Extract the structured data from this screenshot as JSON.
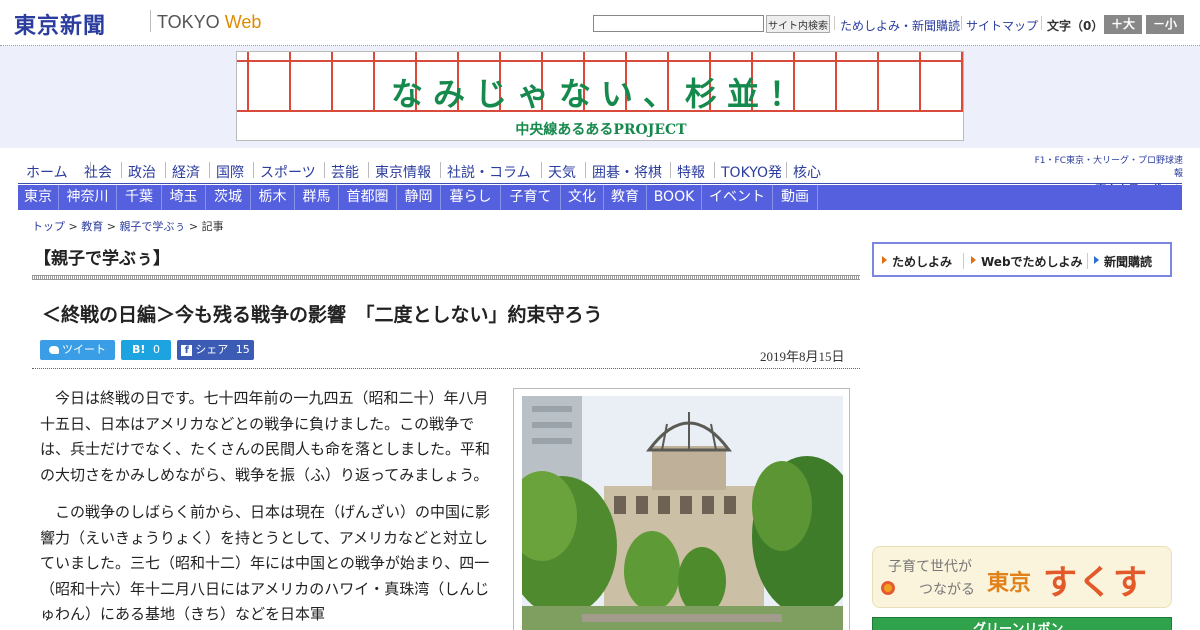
{
  "header": {
    "logo_jp": "東京新聞",
    "logo_en_tokyo": "TOKYO",
    "logo_en_web": "Web",
    "search_placeholder": "",
    "search_button": "サイト内検索",
    "links": [
      "ためしよみ・新聞購読",
      "サイトマップ"
    ],
    "font_size_label": "文字（0）",
    "font_bigger": "＋大",
    "font_smaller": "－小"
  },
  "banner": {
    "title": "なみじゃない、杉並！",
    "subtitle": "中央線あるあるPROJECT"
  },
  "nav_primary": [
    "ホーム",
    "社会",
    "政治",
    "経済",
    "国際",
    "スポーツ",
    "芸能",
    "東京情報",
    "社説・コラム",
    "天気",
    "囲碁・将棋",
    "特報",
    "TOKYO発",
    "核心"
  ],
  "sports_promo": {
    "line1": "F1・FC東京・大リーグ・プロ野球速報",
    "line2": "東京中日スポーツ"
  },
  "nav_regional": [
    "東京",
    "神奈川",
    "千葉",
    "埼玉",
    "茨城",
    "栃木",
    "群馬",
    "首都圏",
    "静岡",
    "暮らし",
    "子育て",
    "文化",
    "教育",
    "BOOK",
    "イベント",
    "動画"
  ],
  "breadcrumb": {
    "items": [
      "トップ",
      "教育",
      "親子で学ぶぅ"
    ],
    "current": "記事",
    "sep": " > "
  },
  "section_title": "【親子で学ぶぅ】",
  "article": {
    "title": "＜終戦の日編＞今も残る戦争の影響　「二度としない」約束守ろう",
    "date": "2019年8月15日",
    "share": {
      "tweet": "ツイート",
      "hatena": "B!",
      "hatena_count": "0",
      "fb_label": "シェア",
      "fb_count": "15"
    },
    "paragraphs": [
      "今日は終戦の日です。七十四年前の一九四五（昭和二十）年八月十五日、日本はアメリカなどとの戦争に負けました。この戦争では、兵士だけでなく、たくさんの民間人も命を落としました。平和の大切さをかみしめながら、戦争を振（ふ）り返ってみましょう。",
      "この戦争のしばらく前から、日本は現在（げんざい）の中国に影響力（えいきょうりょく）を持とうとして、アメリカなどと対立していました。三七（昭和十二）年には中国との戦争が始まり、四一（昭和十六）年十二月八日にはアメリカのハワイ・真珠湾（しんじゅわん）にある基地（きち）などを日本軍"
    ]
  },
  "sidebar": {
    "subscribe_links": [
      "ためしよみ",
      "Webでためしよみ",
      "新聞購読"
    ],
    "sukusuku": {
      "line1": "子育て世代が",
      "line2": "つながる",
      "tokyo": "東京",
      "big": "すくすく"
    },
    "green_ad": "グリーンリボン"
  },
  "colors": {
    "brand_blue": "#2b3d9e",
    "nav_regional_bg": "#5560df",
    "twitter": "#3a9ee6",
    "hatena": "#1da3e0",
    "facebook": "#3b5bb5",
    "banner_green": "#16894c"
  }
}
